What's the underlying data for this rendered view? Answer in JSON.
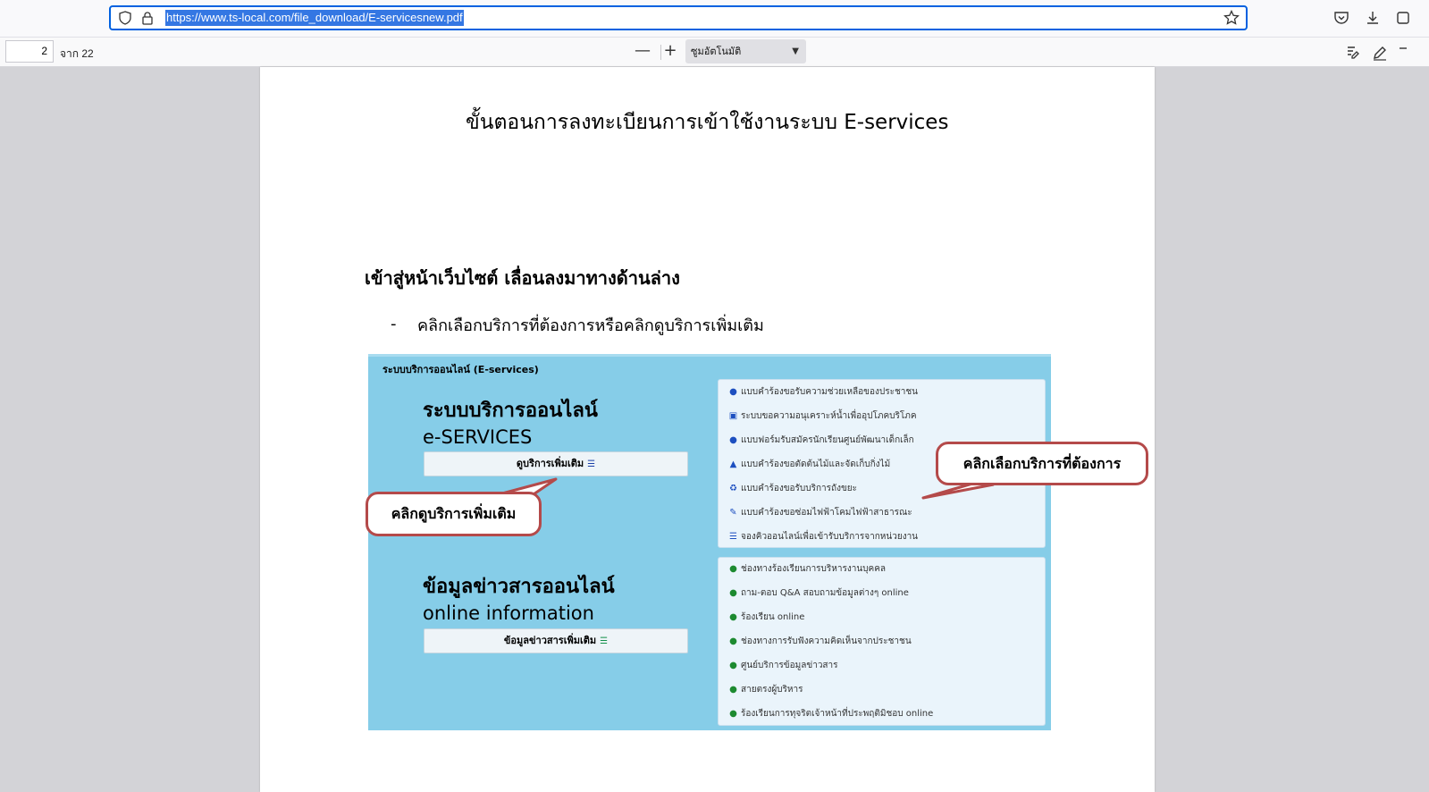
{
  "browser": {
    "url": "https://www.ts-local.com/file_download/E-servicesnew.pdf"
  },
  "pdf_toolbar": {
    "page_number": "2",
    "page_count_label": "จาก 22",
    "zoom_out": "—",
    "zoom_in": "+",
    "zoom_value": "ซูมอัตโนมัติ"
  },
  "document": {
    "title": "ขั้นตอนการลงทะเบียนการเข้าใช้งานระบบ   E-services",
    "heading": "เข้าสู่หน้าเว็บไซต์ เลื่อนลงมาทางด้านล่าง",
    "bullet_dash": "-",
    "bullet": "คลิกเลือกบริการที่ต้องการหรือคลิกดูบริการเพิ่มเติม"
  },
  "screenshot": {
    "header": "ระบบบริการออนไลน์ (E-services)",
    "eservices_title": "ระบบบริการออนไลน์",
    "eservices_subtitle": "e-SERVICES",
    "more_services_button": "ดูบริการเพิ่มเติม",
    "info_title": "ข้อมูลข่าวสารออนไลน์",
    "info_subtitle": "online information",
    "more_info_button": "ข้อมูลข่าวสารเพิ่มเติม",
    "services": [
      {
        "label": "แบบคำร้องขอรับความช่วยเหลือของประชาชน",
        "icon": "users-icon"
      },
      {
        "label": "ระบบขอความอนุเคราะห์น้ำเพื่ออุปโภคบริโภค",
        "icon": "id-card-icon"
      },
      {
        "label": "แบบฟอร์มรับสมัครนักเรียนศูนย์พัฒนาเด็กเล็ก",
        "icon": "chat-icon"
      },
      {
        "label": "แบบคำร้องขอตัดต้นไม้และจัดเก็บกิ่งไม้",
        "icon": "tree-icon"
      },
      {
        "label": "แบบคำร้องขอรับบริการถังขยะ",
        "icon": "recycle-icon"
      },
      {
        "label": "แบบคำร้องขอซ่อมไฟฟ้าโคมไฟฟ้าสาธารณะ",
        "icon": "wrench-icon"
      },
      {
        "label": "จองคิวออนไลน์เพื่อเข้ารับบริการจากหน่วยงาน",
        "icon": "list-icon"
      }
    ],
    "info_items": [
      {
        "label": "ช่องทางร้องเรียนการบริหารงานบุคคล",
        "icon": "users-icon"
      },
      {
        "label": "ถาม-ตอบ Q&A สอบถามข้อมูลต่างๆ online",
        "icon": "users-icon"
      },
      {
        "label": "ร้องเรียน online",
        "icon": "users-icon"
      },
      {
        "label": "ช่องทางการรับฟังความคิดเห็นจากประชาชน",
        "icon": "users-icon"
      },
      {
        "label": "ศูนย์บริการข้อมูลข่าวสาร",
        "icon": "users-icon"
      },
      {
        "label": "สายตรงผู้บริหาร",
        "icon": "users-icon"
      },
      {
        "label": "ร้องเรียนการทุจริตเจ้าหน้าที่ประพฤติมิชอบ online",
        "icon": "users-icon"
      }
    ],
    "callout_more": "คลิกดูบริการเพิ่มเติม",
    "callout_select": "คลิกเลือกบริการที่ต้องการ"
  },
  "colors": {
    "screenshot_background": "#86cde8",
    "callout_border": "#b44a4a",
    "url_highlight": "#3477e3"
  }
}
